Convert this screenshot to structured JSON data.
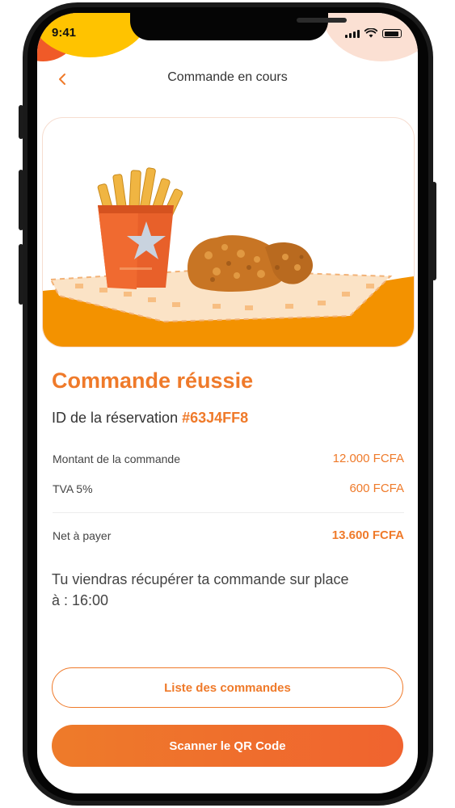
{
  "status_bar": {
    "time": "9:41"
  },
  "header": {
    "title": "Commande en cours",
    "back_icon": "chevron-left-icon"
  },
  "hero_image": {
    "description_icon": "food-illustration"
  },
  "order": {
    "title": "Commande réussie",
    "reservation_label": "ID de la réservation",
    "reservation_id": "#63J4FF8",
    "amount_label": "Montant de la commande",
    "amount_value": "12.000 FCFA",
    "tax_label": "TVA 5%",
    "tax_value": "600 FCFA",
    "net_label": "Net à payer",
    "net_value": "13.600 FCFA",
    "pickup_text": "Tu viendras récupérer ta commande sur place",
    "pickup_time": "à : 16:00"
  },
  "actions": {
    "orders_list_label": "Liste des commandes",
    "scan_qr_label": "Scanner le QR Code"
  },
  "colors": {
    "accent": "#ef7a2a",
    "accent_dark": "#f0632f",
    "yellow": "#ffc300"
  }
}
